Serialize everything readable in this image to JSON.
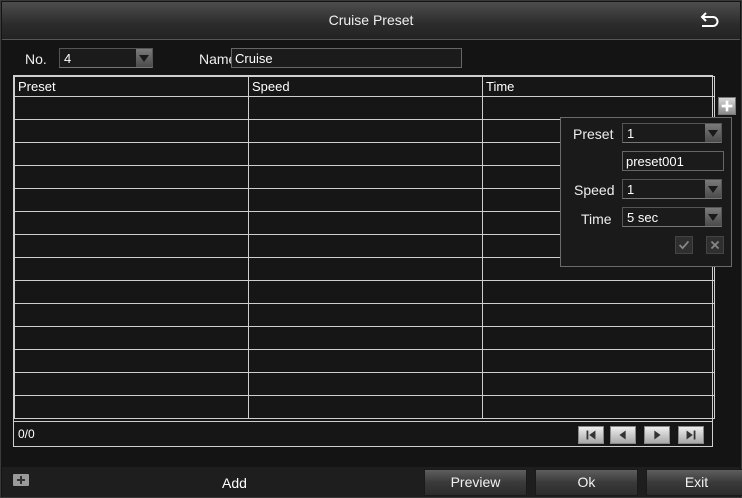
{
  "title": "Cruise Preset",
  "form": {
    "no_label": "No.",
    "no_value": "4",
    "name_label": "Name",
    "name_value": "Cruise"
  },
  "table": {
    "columns": [
      "Preset",
      "Speed",
      "Time"
    ],
    "rows": 14
  },
  "status": {
    "count": "0/0"
  },
  "popup": {
    "preset_label": "Preset",
    "preset_value": "1",
    "preset_name": "preset001",
    "speed_label": "Speed",
    "speed_value": "1",
    "time_label": "Time",
    "time_value": "5 sec"
  },
  "bottom": {
    "add_label": "Add",
    "preview_label": "Preview",
    "ok_label": "Ok",
    "exit_label": "Exit"
  },
  "icons": {
    "back": "back-arrow-icon",
    "add": "plus-icon",
    "first": "first-page-icon",
    "prev": "previous-page-icon",
    "next": "next-page-icon",
    "last": "last-page-icon",
    "confirm": "check-icon",
    "cancel": "close-icon"
  }
}
